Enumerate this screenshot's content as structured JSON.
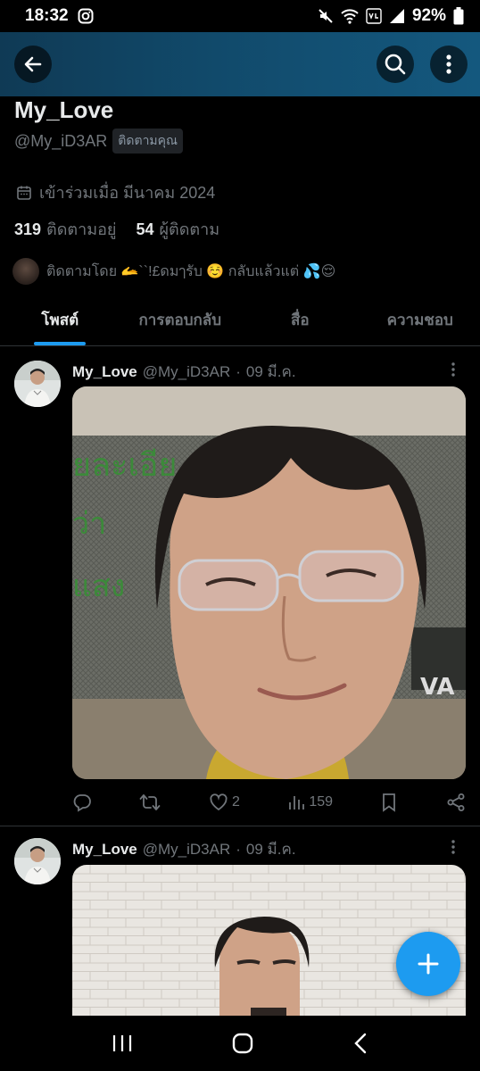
{
  "status_bar": {
    "time": "18:32",
    "battery": "92%"
  },
  "profile": {
    "name": "My_Love",
    "handle": "@My_iD3AR",
    "follows_you": "ติดตามคุณ",
    "joined": "เข้าร่วมเมื่อ มีนาคม 2024",
    "following_count": "319",
    "following_label": "ติดตามอยู่",
    "followers_count": "54",
    "followers_label": "ผู้ติดตาม",
    "followed_by": "ติดตามโดย 🫴``!£ดมๅรับ ☺️ กลับแล้วแต่ 💦😌"
  },
  "tabs": [
    {
      "label": "โพสต์",
      "active": true
    },
    {
      "label": "การตอบกลับ",
      "active": false
    },
    {
      "label": "สื่อ",
      "active": false
    },
    {
      "label": "ความชอบ",
      "active": false
    }
  ],
  "tweets": [
    {
      "name": "My_Love",
      "handle": "@My_iD3AR",
      "sep": "·",
      "date": "09 มี.ค.",
      "likes": "2",
      "views": "159"
    },
    {
      "name": "My_Love",
      "handle": "@My_iD3AR",
      "sep": "·",
      "date": "09 มี.ค."
    }
  ],
  "colors": {
    "accent": "#1d9bf0",
    "header_bg": "#114a6b",
    "muted": "#71767b"
  },
  "icons": [
    "back-arrow-icon",
    "search-icon",
    "more-vertical-icon",
    "calendar-icon",
    "reply-icon",
    "retweet-icon",
    "heart-icon",
    "views-icon",
    "bookmark-icon",
    "share-icon",
    "plus-icon"
  ]
}
